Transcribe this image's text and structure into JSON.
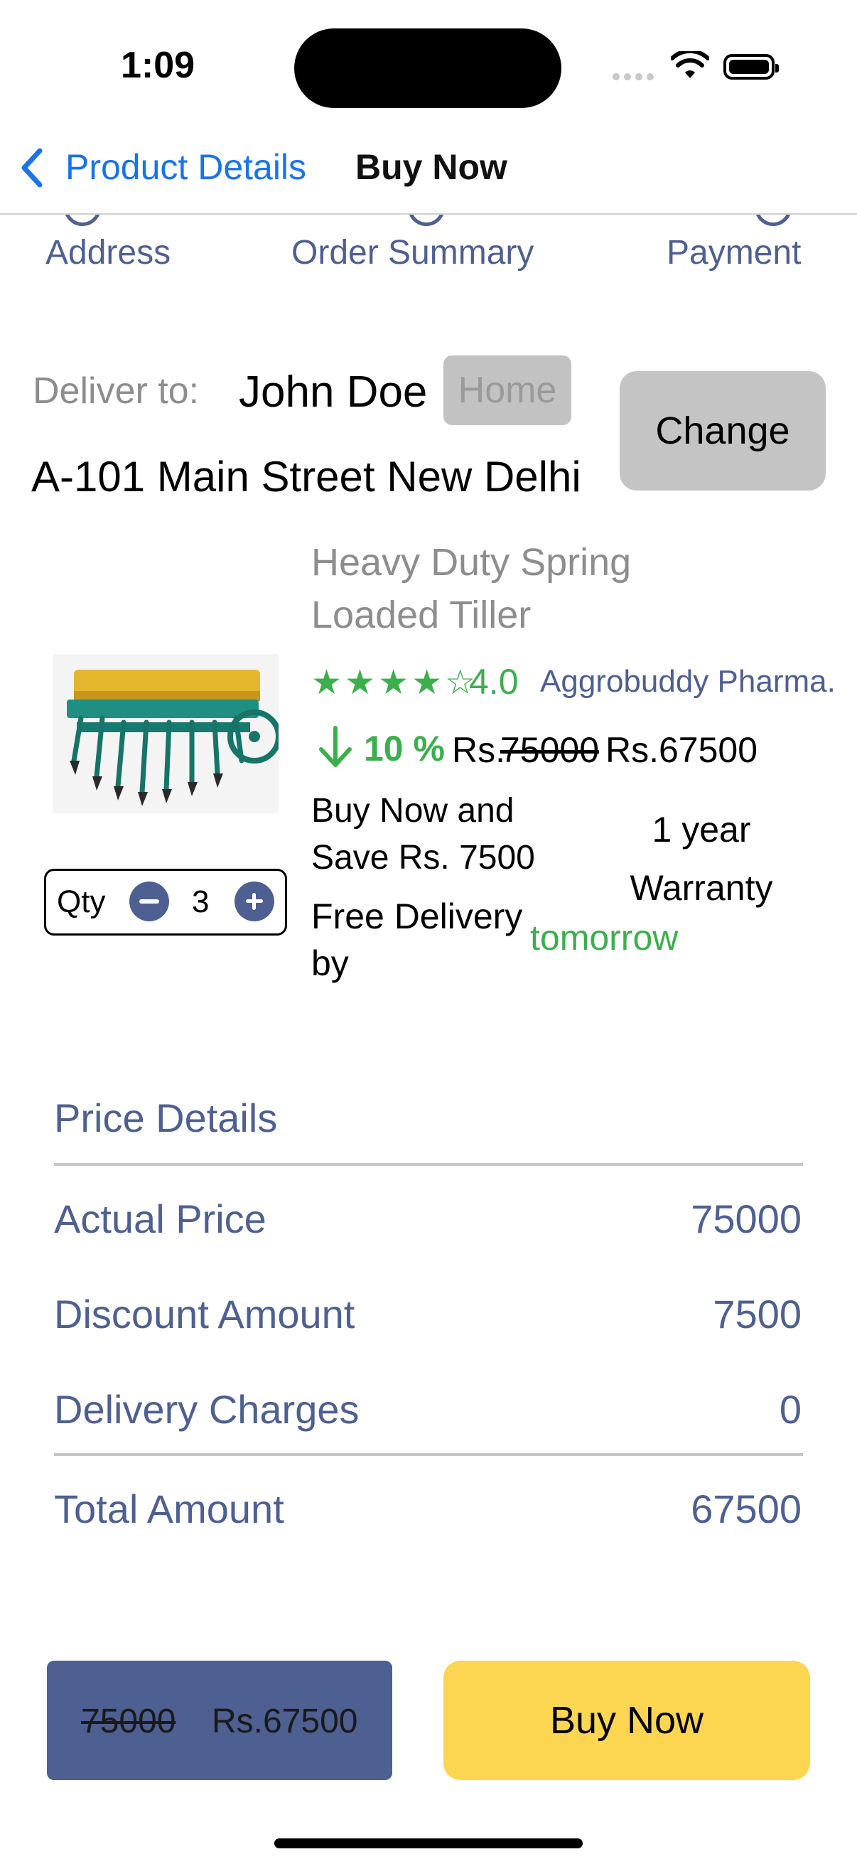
{
  "status_bar": {
    "time": "1:09"
  },
  "nav": {
    "back_label": "Product Details",
    "title": "Buy Now"
  },
  "stepper": {
    "steps": [
      "Address",
      "Order Summary",
      "Payment"
    ]
  },
  "delivery": {
    "label": "Deliver to:",
    "name": "John Doe",
    "tag": "Home",
    "address": "A-101 Main Street New Delhi",
    "change_label": "Change"
  },
  "product": {
    "name": "Heavy Duty Spring Loaded Tiller",
    "stars_text": "★★★★☆",
    "rating": 4.0,
    "rating_text": "4.0",
    "seller": "Aggrobuddy Pharma.",
    "discount": "10 %",
    "currency_prefix": "Rs.",
    "original_price": "75000",
    "price": "Rs.67500",
    "save_text": "Buy Now and Save Rs. 7500",
    "warranty": "1 year Warranty",
    "delivery_prefix": "Free Delivery by",
    "delivery_day": "tomorrow",
    "qty_label": "Qty",
    "qty": "3"
  },
  "price_details": {
    "title": "Price Details",
    "rows": [
      {
        "label": "Actual Price",
        "value": "75000"
      },
      {
        "label": "Discount Amount",
        "value": "7500"
      },
      {
        "label": "Delivery Charges",
        "value": "0"
      }
    ],
    "total": {
      "label": "Total Amount",
      "value": "67500"
    }
  },
  "bottom_bar": {
    "old_price": "75000",
    "price": "Rs.67500",
    "buy_now_label": "Buy Now"
  },
  "colors": {
    "accent_blue": "#4e5f91",
    "link_blue": "#1a73e8",
    "green": "#3caf4d",
    "yellow": "#fdd651",
    "gray_button": "#c4c4c4"
  }
}
